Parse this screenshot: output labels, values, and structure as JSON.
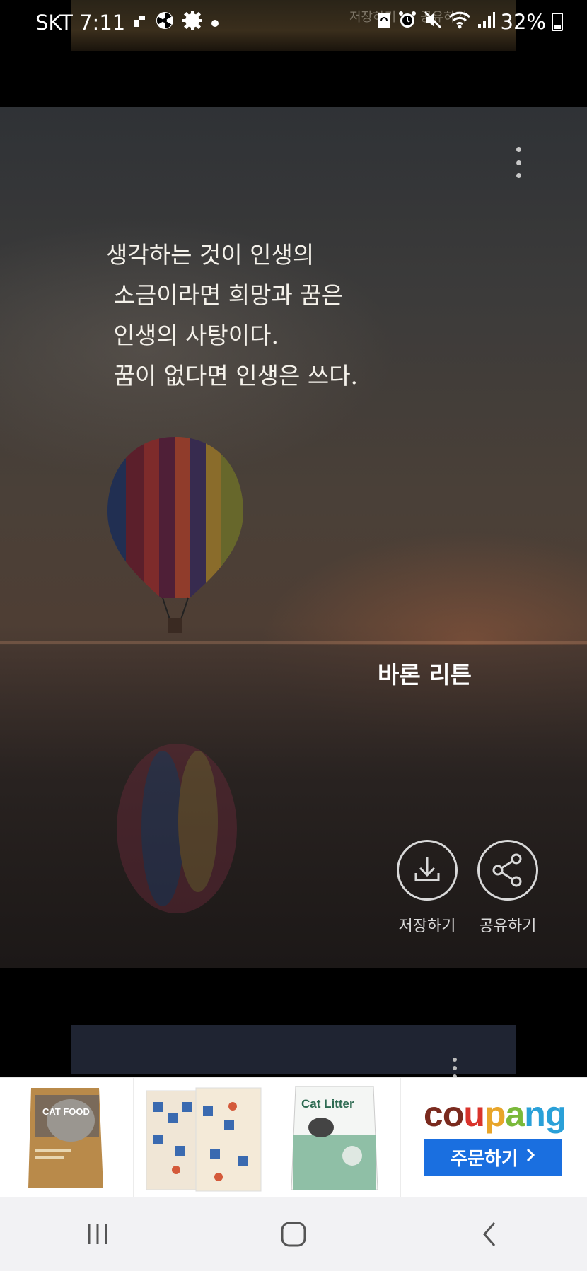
{
  "status_bar": {
    "carrier_time": "SKT 7:11",
    "battery": "32%",
    "icons_left": [
      "photo-icon",
      "radiation-icon",
      "settings-icon",
      "dot-icon"
    ],
    "icons_right": [
      "sync-icon",
      "alarm-icon",
      "mute-icon",
      "wifi-icon",
      "signal-icon",
      "battery-icon"
    ]
  },
  "prev_card": {
    "ghost_save": "저장하기",
    "ghost_share": "공유하기"
  },
  "card": {
    "quote_lines": [
      "생각하는 것이 인생의",
      " 소금이라면 희망과 꿈은",
      " 인생의 사탕이다.",
      " 꿈이 없다면 인생은 쓰다."
    ],
    "author": "바론 리튼",
    "save_label": "저장하기",
    "share_label": "공유하기"
  },
  "ad": {
    "brand": "coupang",
    "order_label": "주문하기",
    "products": [
      "cat-food-product",
      "cat-toy-box-product",
      "cat-litter-product"
    ],
    "product_texts": {
      "cat_food": "CAT FOOD",
      "cat_litter": "Cat Litter"
    }
  },
  "colors": {
    "coupang_blue": "#1a6fe0",
    "background": "#000000"
  }
}
